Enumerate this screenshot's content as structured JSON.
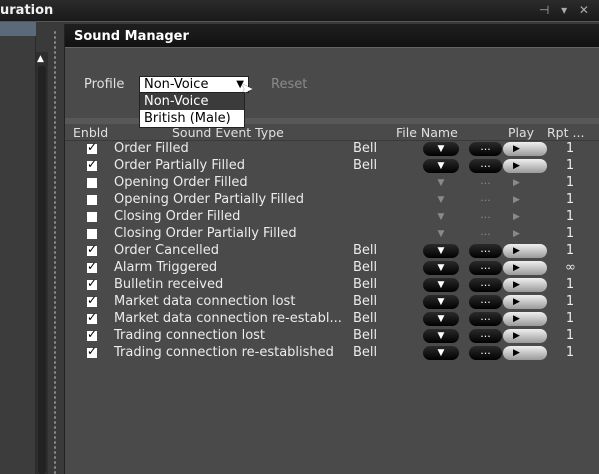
{
  "background": {
    "title": "uration",
    "controls": "⊣ ▾ ✕"
  },
  "dialog": {
    "title": "Sound Manager",
    "profile_label": "Profile",
    "profile_value": "Non-Voice",
    "reset_label": "Reset",
    "dropdown_options": [
      "Non-Voice",
      "British (Male)"
    ]
  },
  "table": {
    "headers": {
      "enabled": "Enbld",
      "event": "Sound Event Type",
      "file": "File Name",
      "play": "Play",
      "rpt": "Rpt ..."
    },
    "rows": [
      {
        "enabled": true,
        "event": "Order Filled",
        "file": "Bell",
        "rpt": "1"
      },
      {
        "enabled": true,
        "event": "Order Partially Filled",
        "file": "Bell",
        "rpt": "1"
      },
      {
        "enabled": false,
        "event": "Opening Order Filled",
        "file": "",
        "rpt": "1"
      },
      {
        "enabled": false,
        "event": "Opening Order Partially Filled",
        "file": "",
        "rpt": "1"
      },
      {
        "enabled": false,
        "event": "Closing Order Filled",
        "file": "",
        "rpt": "1"
      },
      {
        "enabled": false,
        "event": "Closing Order Partially Filled",
        "file": "",
        "rpt": "1"
      },
      {
        "enabled": true,
        "event": "Order Cancelled",
        "file": "Bell",
        "rpt": "1"
      },
      {
        "enabled": true,
        "event": "Alarm Triggered",
        "file": "Bell",
        "rpt": "∞"
      },
      {
        "enabled": true,
        "event": "Bulletin received",
        "file": "Bell",
        "rpt": "1"
      },
      {
        "enabled": true,
        "event": "Market data connection lost",
        "file": "Bell",
        "rpt": "1"
      },
      {
        "enabled": true,
        "event": "Market data connection re-establ...",
        "file": "Bell",
        "rpt": "1"
      },
      {
        "enabled": true,
        "event": "Trading connection lost",
        "file": "Bell",
        "rpt": "1"
      },
      {
        "enabled": true,
        "event": "Trading connection re-established",
        "file": "Bell",
        "rpt": "1"
      }
    ],
    "glyphs": {
      "dropdown": "▼",
      "browse": "...",
      "play": "▶"
    }
  }
}
